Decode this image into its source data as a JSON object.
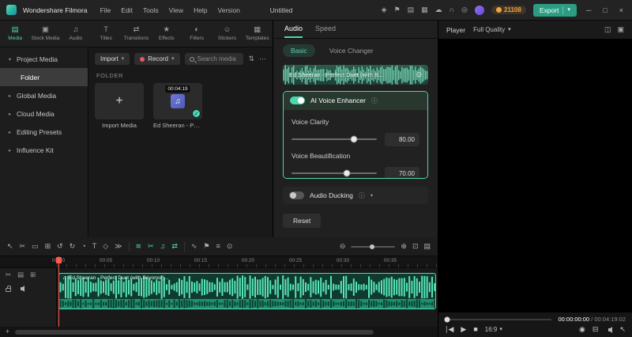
{
  "accent": "#4fd6ae",
  "glyphs": {
    "caret_down": "▾",
    "caret_right": "▸",
    "more": "⋯",
    "filter": "⇅",
    "info": "ⓘ",
    "adjust": "⊙",
    "check": "✓",
    "plus": "+",
    "music": "♫",
    "play": "▶",
    "stop": "■",
    "skip_back": "∣◀",
    "minimize": "─",
    "maximize": "□",
    "close": "×"
  },
  "titlebar": {
    "app_name": "Wondershare Filmora",
    "menus": [
      "File",
      "Edit",
      "Tools",
      "View",
      "Help",
      "Version"
    ],
    "project_name": "Untitled",
    "icon_glyphs": {
      "gift": "◈",
      "megaphone": "⚑",
      "display": "▤",
      "keyboard": "▦",
      "cloud": "☁",
      "headset": "∩",
      "bell": "◎"
    },
    "coin_count": "21108",
    "export_label": "Export"
  },
  "media_tabs": [
    {
      "label": "Media",
      "glyph": "▤"
    },
    {
      "label": "Stock Media",
      "glyph": "▣"
    },
    {
      "label": "Audio",
      "glyph": "♫"
    },
    {
      "label": "Titles",
      "glyph": "T"
    },
    {
      "label": "Transitions",
      "glyph": "⇄"
    },
    {
      "label": "Effects",
      "glyph": "★"
    },
    {
      "label": "Filters",
      "glyph": "◐"
    },
    {
      "label": "Stickers",
      "glyph": "☺"
    },
    {
      "label": "Templates",
      "glyph": "▦"
    }
  ],
  "sidebar": [
    {
      "label": "Project Media",
      "caret": "▾"
    },
    {
      "label": "Folder"
    },
    {
      "label": "Global Media",
      "caret": "▸"
    },
    {
      "label": "Cloud Media",
      "caret": "▸"
    },
    {
      "label": "Editing Presets",
      "caret": "▸"
    },
    {
      "label": "Influence Kit",
      "caret": "▸"
    }
  ],
  "media_panel": {
    "import_label": "Import",
    "record_label": "Record",
    "search_placeholder": "Search media",
    "section_label": "FOLDER",
    "import_card_label": "Import Media",
    "clip_name": "Ed Sheeran - Per...",
    "clip_duration": "00:04:19"
  },
  "properties": {
    "tabs": [
      {
        "label": "Audio"
      },
      {
        "label": "Speed"
      }
    ],
    "subtabs": [
      {
        "label": "Basic"
      },
      {
        "label": "Voice Changer"
      }
    ],
    "clip_title": "Ed Sheeran - Perfect Duet (with B...",
    "ai_section": {
      "title": "AI Voice Enhancer",
      "enabled": true
    },
    "params": [
      {
        "label": "Voice Clarity",
        "value": "80.00"
      },
      {
        "label": "Voice Beautification",
        "value": "70.00"
      }
    ],
    "ducking": {
      "label": "Audio Ducking",
      "enabled": false
    },
    "reset_label": "Reset"
  },
  "player": {
    "title": "Player",
    "quality": "Full Quality",
    "timecode_current": "00:00:00:00",
    "timecode_separator": "/",
    "timecode_total": "00:04:19:02",
    "aspect_ratio": "16:9",
    "header_icons": [
      {
        "name": "dual-view",
        "glyph": "◫"
      },
      {
        "name": "compact-view",
        "glyph": "▣"
      }
    ],
    "right_icons": [
      {
        "name": "snapshot",
        "glyph": "◉"
      },
      {
        "name": "mirror-display",
        "glyph": "⊟"
      },
      {
        "name": "pointer",
        "glyph": "↖"
      }
    ]
  },
  "timeline": {
    "ruler": [
      "00:00",
      "00:05",
      "00:10",
      "00:15",
      "00:20",
      "00:25",
      "00:30",
      "00:35"
    ],
    "clip_label": "Ed Sheeran - Perfect Duet (with Beyoncé)...",
    "tools_left": [
      {
        "glyph": "↖"
      },
      {
        "glyph": "✂"
      },
      {
        "glyph": "▭"
      },
      {
        "glyph": "⊞"
      },
      {
        "glyph": "↺"
      },
      {
        "glyph": "↻"
      },
      {
        "glyph": "◔"
      },
      {
        "glyph": "T"
      },
      {
        "glyph": "◇"
      },
      {
        "glyph": "≫"
      }
    ],
    "tools_ai": [
      {
        "glyph": "≋"
      },
      {
        "glyph": "✂"
      },
      {
        "glyph": "♫"
      },
      {
        "glyph": "⇄"
      }
    ],
    "tools_audio": [
      {
        "glyph": "∿"
      },
      {
        "glyph": "⚑"
      },
      {
        "glyph": "≡"
      },
      {
        "glyph": "⊙"
      }
    ],
    "header_tools": [
      {
        "glyph": "✂"
      },
      {
        "glyph": "▤"
      },
      {
        "glyph": "⊞"
      }
    ],
    "zoom": {
      "out": "⊖",
      "in": "⊕",
      "fit": "⊡",
      "tracks": "▤"
    },
    "add_label": "+"
  }
}
